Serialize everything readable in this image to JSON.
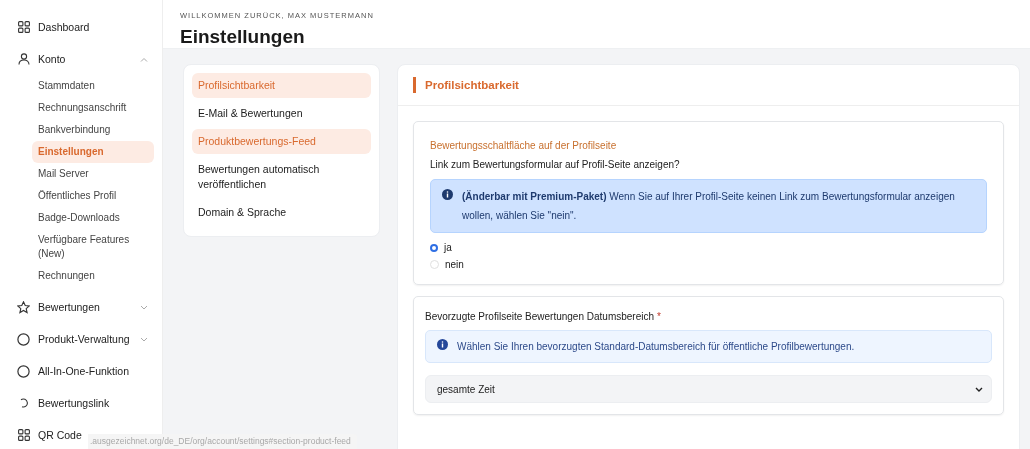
{
  "header": {
    "greeting": "WILLKOMMEN ZURÜCK, MAX MUSTERMANN",
    "title": "Einstellungen"
  },
  "sidebar": {
    "items": [
      {
        "label": "Dashboard",
        "selected": false
      },
      {
        "label": "Konto",
        "selected": false,
        "expanded": true,
        "children": [
          {
            "label": "Stammdaten",
            "selected": false
          },
          {
            "label": "Rechnungsanschrift",
            "selected": false
          },
          {
            "label": "Bankverbindung",
            "selected": false
          },
          {
            "label": "Einstellungen",
            "selected": true
          },
          {
            "label": "Mail Server",
            "selected": false
          },
          {
            "label": "Öffentliches Profil",
            "selected": false
          },
          {
            "label": "Badge-Downloads",
            "selected": false
          },
          {
            "label": "Verfügbare Features (New)",
            "selected": false
          },
          {
            "label": "Rechnungen",
            "selected": false
          }
        ]
      },
      {
        "label": "Bewertungen",
        "selected": false,
        "expanded": false
      },
      {
        "label": "Produkt-Verwaltung",
        "selected": false,
        "expanded": false
      },
      {
        "label": "All-In-One-Funktion",
        "selected": false
      },
      {
        "label": "Bewertungslink",
        "selected": false
      },
      {
        "label": "QR Code",
        "selected": false
      }
    ]
  },
  "settings_nav": {
    "items": [
      {
        "label": "Profilsichtbarkeit",
        "selected": true
      },
      {
        "label": "E-Mail & Bewertungen",
        "selected": false
      },
      {
        "label": "Produktbewertungs-Feed",
        "selected": true
      },
      {
        "label": "Bewertungen automatisch veröffentlichen",
        "selected": false
      },
      {
        "label": "Domain & Sprache",
        "selected": false
      }
    ]
  },
  "panel": {
    "title": "Profilsichtbarkeit",
    "sections": [
      {
        "kind": "radio",
        "heading": "Bewertungsschaltfläche auf der Profilseite",
        "question": "Link zum Bewertungsformular auf Profil-Seite anzeigen?",
        "info": "**(Änderbar mit Premium-Paket)** Wenn Sie auf Ihrer Profil-Seite keinen Link zum Bewertungsformular anzeigen wollen, wählen Sie \"nein\".",
        "options": [
          {
            "label": "ja",
            "selected": true
          },
          {
            "label": "nein",
            "selected": false
          }
        ]
      },
      {
        "kind": "select",
        "label": "Bevorzugte Profilseite Bewertungen Datumsbereich",
        "required_mark": "*",
        "info": "Wählen Sie Ihren bevorzugten Standard-Datumsbereich für öffentliche Profilbewertungen.",
        "value": "gesamte Zeit"
      }
    ]
  },
  "status_url": ".ausgezeichnet.org/de_DE/org/account/settings#section-product-feed"
}
